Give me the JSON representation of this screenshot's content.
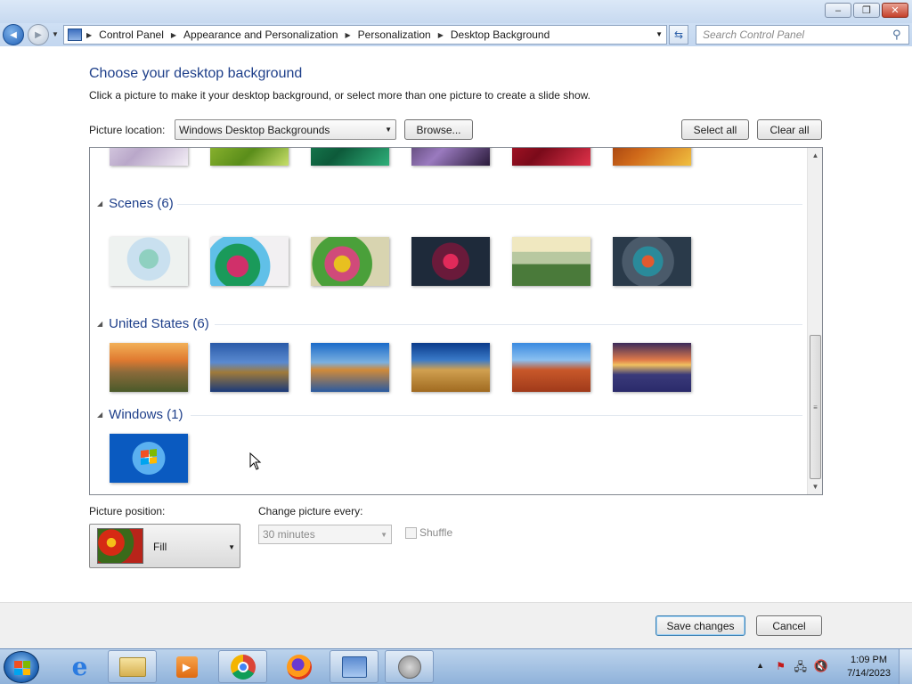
{
  "window": {
    "buttons": {
      "minimize": "–",
      "maximize": "❐",
      "close": "✕"
    }
  },
  "navbar": {
    "back_glyph": "◀",
    "forward_glyph": "▶",
    "breadcrumbs": [
      "Control Panel",
      "Appearance and Personalization",
      "Personalization",
      "Desktop Background"
    ],
    "search_placeholder": "Search Control Panel"
  },
  "page": {
    "title": "Choose your desktop background",
    "description": "Click a picture to make it your desktop background, or select more than one picture to create a slide show.",
    "picture_location_label": "Picture location:",
    "picture_location_value": "Windows Desktop Backgrounds",
    "browse_label": "Browse...",
    "select_all_label": "Select all",
    "clear_all_label": "Clear all"
  },
  "gallery": {
    "groups": [
      {
        "label": "Scenes (6)",
        "count": 6
      },
      {
        "label": "United States (6)",
        "count": 6
      },
      {
        "label": "Windows (1)",
        "count": 1
      }
    ]
  },
  "position": {
    "label": "Picture position:",
    "value": "Fill"
  },
  "slideshow": {
    "label": "Change picture every:",
    "interval": "30 minutes",
    "shuffle_label": "Shuffle",
    "shuffle_checked": false
  },
  "footer": {
    "save_label": "Save changes",
    "cancel_label": "Cancel"
  },
  "taskbar": {
    "apps": [
      "internet-explorer",
      "file-explorer",
      "media-player",
      "chrome",
      "firefox",
      "control-panel",
      "volume-settings"
    ],
    "time": "1:09 PM",
    "date": "7/14/2023"
  }
}
